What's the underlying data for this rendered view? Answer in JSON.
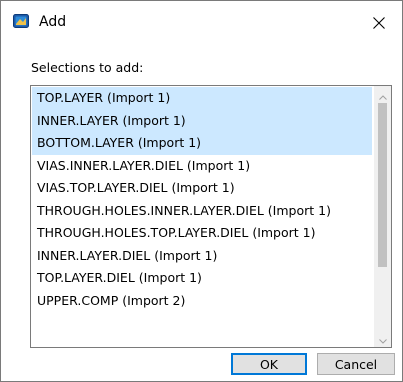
{
  "window": {
    "title": "Add",
    "icon": "app-dialog-icon",
    "close_icon": "close-icon"
  },
  "prompt": "Selections to add:",
  "list": {
    "items": [
      {
        "label": "TOP.LAYER (Import 1)",
        "selected": true
      },
      {
        "label": "INNER.LAYER (Import 1)",
        "selected": true
      },
      {
        "label": "BOTTOM.LAYER (Import 1)",
        "selected": true
      },
      {
        "label": "VIAS.INNER.LAYER.DIEL (Import 1)",
        "selected": false
      },
      {
        "label": "VIAS.TOP.LAYER.DIEL (Import 1)",
        "selected": false
      },
      {
        "label": "THROUGH.HOLES.INNER.LAYER.DIEL (Import 1)",
        "selected": false
      },
      {
        "label": "THROUGH.HOLES.TOP.LAYER.DIEL (Import 1)",
        "selected": false
      },
      {
        "label": "INNER.LAYER.DIEL (Import 1)",
        "selected": false
      },
      {
        "label": "TOP.LAYER.DIEL (Import 1)",
        "selected": false
      },
      {
        "label": "UPPER.COMP (Import 2)",
        "selected": false
      }
    ]
  },
  "buttons": {
    "ok": "OK",
    "cancel": "Cancel"
  },
  "colors": {
    "selection": "#cce8ff",
    "default_button_border": "#0078d7"
  }
}
